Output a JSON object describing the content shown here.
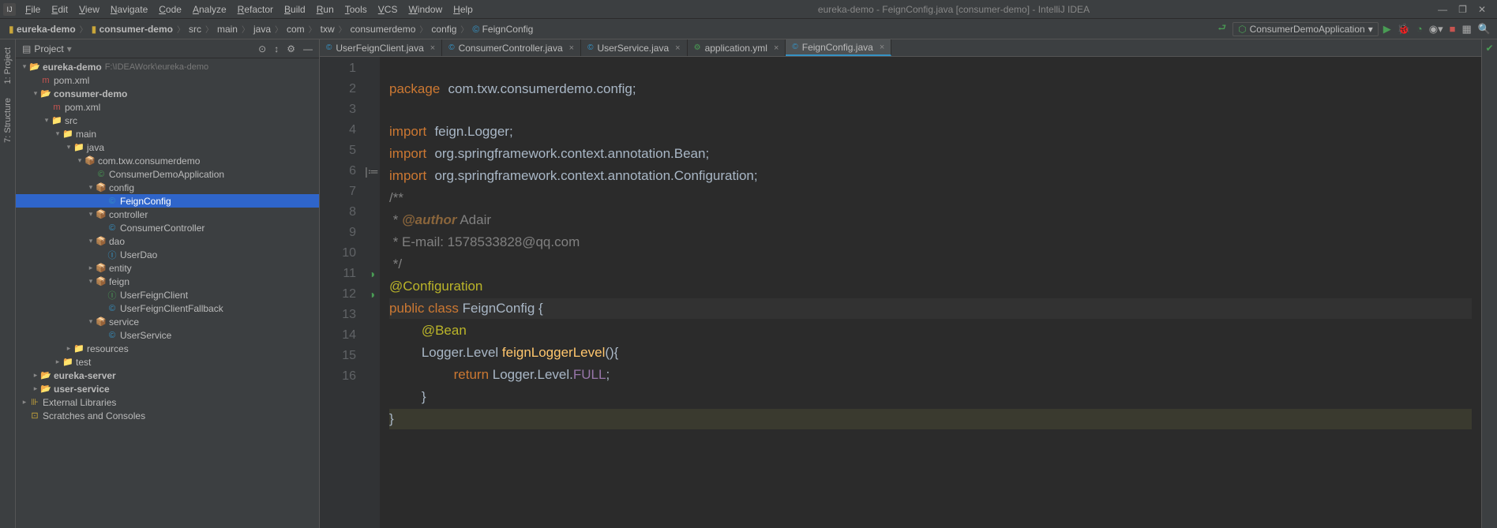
{
  "title": "eureka-demo - FeignConfig.java [consumer-demo] - IntelliJ IDEA",
  "menus": [
    "File",
    "Edit",
    "View",
    "Navigate",
    "Code",
    "Analyze",
    "Refactor",
    "Build",
    "Run",
    "Tools",
    "VCS",
    "Window",
    "Help"
  ],
  "breadcrumb": [
    "eureka-demo",
    "consumer-demo",
    "src",
    "main",
    "java",
    "com",
    "txw",
    "consumerdemo",
    "config",
    "FeignConfig"
  ],
  "run_config": "ConsumerDemoApplication",
  "left_tools": {
    "project": "1: Project",
    "structure": "7: Structure"
  },
  "project_header": {
    "title": "Project"
  },
  "tree": [
    {
      "d": 0,
      "a": "▾",
      "i": "📂",
      "ic": "fold-y",
      "l": "eureka-demo",
      "dim": "F:\\IDEAWork\\eureka-demo",
      "b": true
    },
    {
      "d": 1,
      "a": "",
      "i": "m",
      "ic": "file-m",
      "l": "pom.xml"
    },
    {
      "d": 1,
      "a": "▾",
      "i": "📂",
      "ic": "fold-y",
      "l": "consumer-demo",
      "b": true
    },
    {
      "d": 2,
      "a": "",
      "i": "m",
      "ic": "file-m",
      "l": "pom.xml"
    },
    {
      "d": 2,
      "a": "▾",
      "i": "📁",
      "ic": "fold-b",
      "l": "src"
    },
    {
      "d": 3,
      "a": "▾",
      "i": "📁",
      "ic": "fold-b",
      "l": "main"
    },
    {
      "d": 4,
      "a": "▾",
      "i": "📁",
      "ic": "fold-b",
      "l": "java"
    },
    {
      "d": 5,
      "a": "▾",
      "i": "📦",
      "ic": "fold-y",
      "l": "com.txw.consumerdemo"
    },
    {
      "d": 6,
      "a": "",
      "i": "©",
      "ic": "file-g",
      "l": "ConsumerDemoApplication"
    },
    {
      "d": 6,
      "a": "▾",
      "i": "📦",
      "ic": "fold-y",
      "l": "config"
    },
    {
      "d": 7,
      "a": "",
      "i": "©",
      "ic": "file-b",
      "l": "FeignConfig",
      "sel": true
    },
    {
      "d": 6,
      "a": "▾",
      "i": "📦",
      "ic": "fold-y",
      "l": "controller"
    },
    {
      "d": 7,
      "a": "",
      "i": "©",
      "ic": "file-b",
      "l": "ConsumerController"
    },
    {
      "d": 6,
      "a": "▾",
      "i": "📦",
      "ic": "fold-y",
      "l": "dao"
    },
    {
      "d": 7,
      "a": "",
      "i": "Ⓘ",
      "ic": "file-b",
      "l": "UserDao"
    },
    {
      "d": 6,
      "a": "▸",
      "i": "📦",
      "ic": "fold-y",
      "l": "entity"
    },
    {
      "d": 6,
      "a": "▾",
      "i": "📦",
      "ic": "fold-y",
      "l": "feign"
    },
    {
      "d": 7,
      "a": "",
      "i": "Ⓘ",
      "ic": "file-g",
      "l": "UserFeignClient"
    },
    {
      "d": 7,
      "a": "",
      "i": "©",
      "ic": "file-b",
      "l": "UserFeignClientFallback"
    },
    {
      "d": 6,
      "a": "▾",
      "i": "📦",
      "ic": "fold-y",
      "l": "service"
    },
    {
      "d": 7,
      "a": "",
      "i": "©",
      "ic": "file-b",
      "l": "UserService"
    },
    {
      "d": 4,
      "a": "▸",
      "i": "📁",
      "ic": "fold-y",
      "l": "resources"
    },
    {
      "d": 3,
      "a": "▸",
      "i": "📁",
      "ic": "fold-b",
      "l": "test"
    },
    {
      "d": 1,
      "a": "▸",
      "i": "📂",
      "ic": "fold-y",
      "l": "eureka-server",
      "b": true
    },
    {
      "d": 1,
      "a": "▸",
      "i": "📂",
      "ic": "fold-y",
      "l": "user-service",
      "b": true
    },
    {
      "d": 0,
      "a": "▸",
      "i": "⊪",
      "ic": "file-lib",
      "l": "External Libraries"
    },
    {
      "d": 0,
      "a": "",
      "i": "⊡",
      "ic": "file-lib",
      "l": "Scratches and Consoles"
    }
  ],
  "tabs": [
    {
      "icon": "©",
      "ic": "file-b",
      "label": "UserFeignClient.java"
    },
    {
      "icon": "©",
      "ic": "file-b",
      "label": "ConsumerController.java"
    },
    {
      "icon": "©",
      "ic": "file-b",
      "label": "UserService.java"
    },
    {
      "icon": "⚙",
      "ic": "file-g",
      "label": "application.yml"
    },
    {
      "icon": "©",
      "ic": "file-b",
      "label": "FeignConfig.java",
      "active": true
    }
  ],
  "code_lines": 16,
  "code": {
    "l1_package": "package",
    "l1_pkg": "com.txw.consumerdemo.config",
    "l3_import": "import",
    "l3_a": "feign.Logger",
    "l4_import": "import",
    "l4_a": "org.springframework.context.annotation.Bean",
    "l5_import": "import",
    "l5_a": "org.springframework.context.annotation.Configuration",
    "l6": "/**",
    "l7_a": " * ",
    "l7_tag": "@author",
    "l7_b": " Adair",
    "l8": " * E-mail: 1578533828@qq.com",
    "l9": " */",
    "l10": "@Configuration",
    "l11_public": "public",
    "l11_class": "class",
    "l11_name": "FeignConfig",
    "l12": "@Bean",
    "l13_a": "Logger.Level ",
    "l13_m": "feignLoggerLevel",
    "l14_ret": "return",
    "l14_a": " Logger.Level.",
    "l14_f": "FULL",
    "l15": "}",
    "l16": "}"
  }
}
